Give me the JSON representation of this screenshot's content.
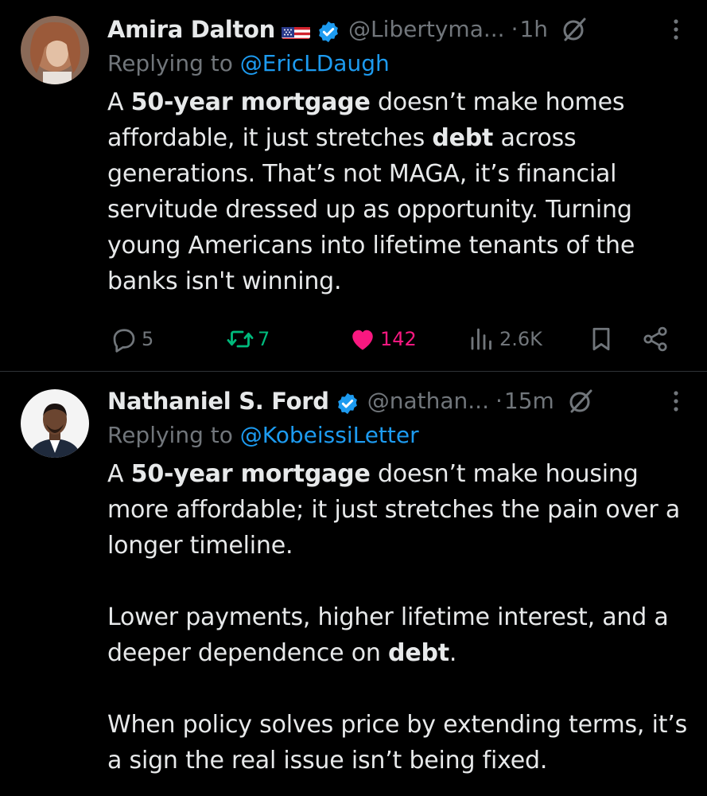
{
  "posts": [
    {
      "name": "Amira Dalton",
      "handle": "@Libertyma...",
      "dot": "·",
      "time": "1h",
      "replying_prefix": "Replying to ",
      "replying_to": "@EricLDaugh",
      "text_segments": [
        {
          "t": "A ",
          "b": false
        },
        {
          "t": "50-year mortgage",
          "b": true
        },
        {
          "t": " doesn’t make homes affordable, it just stretches ",
          "b": false
        },
        {
          "t": "debt",
          "b": true
        },
        {
          "t": " across generations. That’s not MAGA, it’s financial servitude dressed up as opportunity. Turning young Americans into lifetime tenants of the banks isn't winning.",
          "b": false
        }
      ],
      "replies": "5",
      "reposts": "7",
      "likes": "142",
      "views": "2.6K",
      "colors": {
        "repost": "#00ba7c",
        "like": "#f91880"
      }
    },
    {
      "name": "Nathaniel S. Ford",
      "handle": "@nathan...",
      "dot": "·",
      "time": "15m",
      "replying_prefix": "Replying to ",
      "replying_to": "@KobeissiLetter",
      "para1": [
        {
          "t": "A ",
          "b": false
        },
        {
          "t": "50-year mortgage",
          "b": true
        },
        {
          "t": " doesn’t make housing more affordable; it just stretches the pain over a longer timeline.",
          "b": false
        }
      ],
      "para2": [
        {
          "t": "Lower payments, higher lifetime interest, and a deeper dependence on ",
          "b": false
        },
        {
          "t": "debt",
          "b": true
        },
        {
          "t": ".",
          "b": false
        }
      ],
      "para3": [
        {
          "t": "When policy solves price by extending terms, it’s a sign the real issue isn’t being fixed.",
          "b": false
        }
      ]
    }
  ],
  "icons": {
    "verified": "verified-badge-icon",
    "flag": "us-flag-icon",
    "grok": "grok-icon",
    "more": "more-vertical-icon",
    "reply": "reply-icon",
    "repost": "repost-icon",
    "like": "like-icon",
    "views": "views-icon",
    "bookmark": "bookmark-icon",
    "share": "share-icon"
  },
  "theme": {
    "background": "#000000",
    "text": "#e7e9ea",
    "muted": "#71767b",
    "link": "#1d9bf0",
    "verified": "#1d9bf0"
  }
}
